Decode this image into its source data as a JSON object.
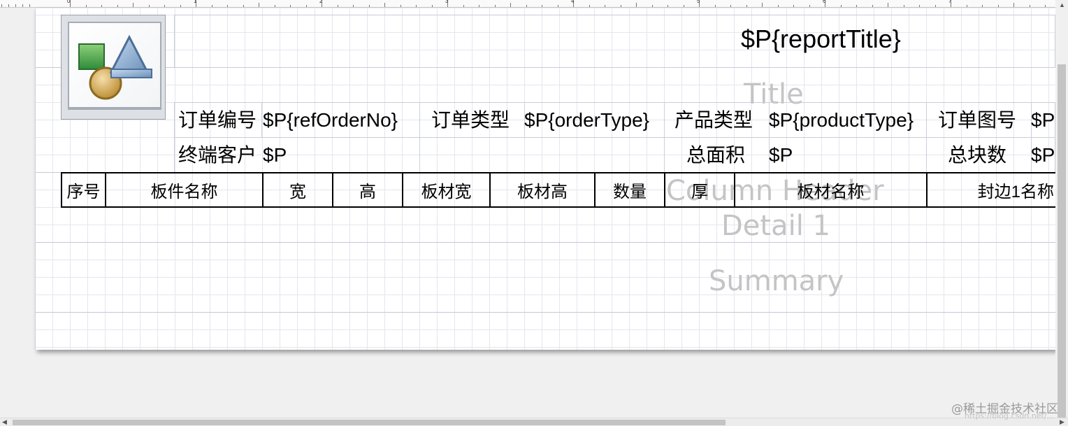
{
  "ruler": {
    "numbers": [
      "0",
      "1",
      "2",
      "3",
      "4",
      "5",
      "6",
      "7"
    ]
  },
  "bands": {
    "title": "Title",
    "column_header": "Column Header",
    "detail": "Detail 1",
    "summary": "Summary"
  },
  "report": {
    "title_field": "$P{reportTitle}",
    "logo_icon": "report-image-placeholder-icon",
    "info_rows": [
      {
        "label1": "订单编号",
        "value1": "$P{refOrderNo}",
        "label2": "订单类型",
        "value2": "$P{orderType}",
        "label3": "产品类型",
        "value3": "$P{productType}",
        "label4": "订单图号",
        "value4": "$P"
      },
      {
        "label1": "终端客户",
        "value1": "$P",
        "label3": "总面积",
        "value3": "$P",
        "label4": "总块数",
        "value4": "$P"
      }
    ],
    "columns": [
      "序号",
      "板件名称",
      "宽",
      "高",
      "板材宽",
      "板材高",
      "数量",
      "厚",
      "板材名称",
      "封边1名称"
    ]
  },
  "watermark": {
    "text": "@稀土掘金技术社区",
    "faint_text": "https://blog.csdn.net/..."
  },
  "colors": {
    "grid": "#e4e6ee",
    "band_label": "#c4c4c4",
    "page": "#ffffff",
    "background": "#f0f0f0"
  }
}
